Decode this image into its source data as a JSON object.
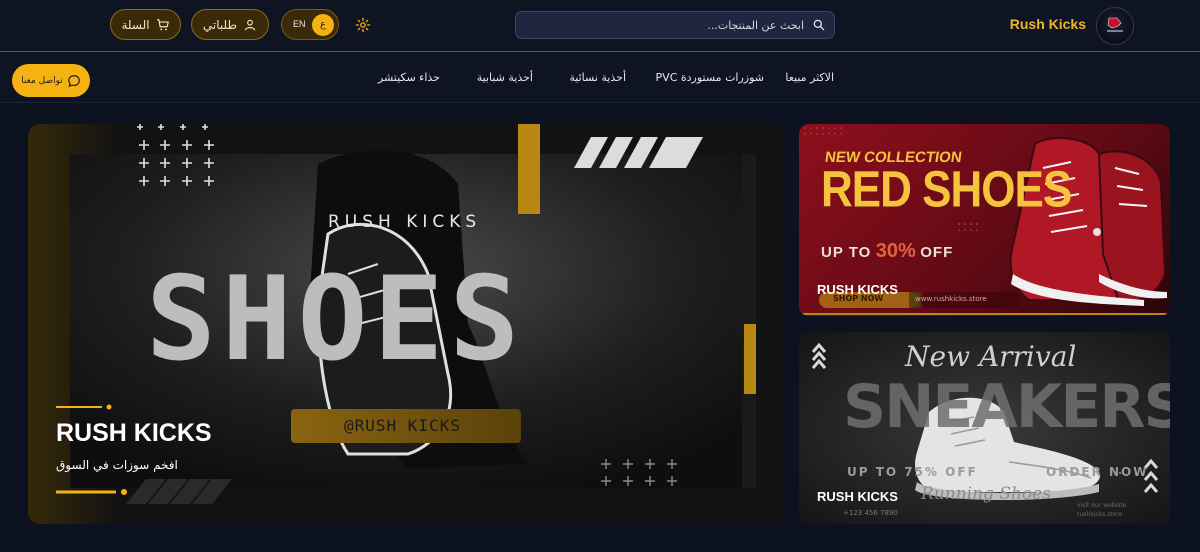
{
  "brand": {
    "name": "Rush Kicks",
    "accent": "#f5b210"
  },
  "search": {
    "placeholder": "ابحث عن المنتجات..."
  },
  "header": {
    "lang_label": "EN",
    "lang_knob": "ع",
    "orders_label": "طلباتي",
    "cart_label": "السلة"
  },
  "nav": {
    "contact_label": "تواصل معنا",
    "items": [
      "الاكثر مبيعا",
      "شوزرات مستوردة PVC",
      "أحذية نسائية",
      "أحذية شبابية",
      "حذاء سكيتشر"
    ]
  },
  "hero": {
    "tagline_top": "RUSH KICKS",
    "big_word": "SHOES",
    "handle": "@RUSH KICKS",
    "title": "RUSH KICKS",
    "subtitle": "افخم سوزات في السوق"
  },
  "promo1": {
    "line1": "NEW COLLECTION",
    "line2": "RED SHOES",
    "offer_prefix": "UP TO",
    "offer_value": "30%",
    "offer_suffix": "OFF",
    "shop": "SHOP NOW",
    "site": "www.rushkicks.store",
    "title": "RUSH KICKS"
  },
  "promo2": {
    "script_top": "New Arrival",
    "big_word": "SNEAKERS",
    "offer_left": "UP TO 75% OFF",
    "offer_right": "ORDER NOW",
    "script_bottom": "Running Shoes",
    "phone": "+123 456 7890",
    "site_label": "visit our website",
    "site": "rushkicks.store",
    "title": "RUSH KICKS"
  }
}
